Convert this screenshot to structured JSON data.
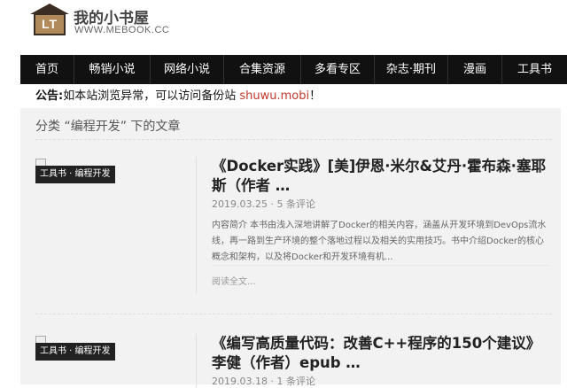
{
  "site": {
    "title": "我的小书屋",
    "url": "WWW.MEBOOK.CC",
    "logo_text": "LT"
  },
  "nav": [
    "首页",
    "畅销小说",
    "网络小说",
    "合集资源",
    "多看专区",
    "杂志·期刊",
    "漫画",
    "工具书"
  ],
  "notice": {
    "label": "公告:",
    "text": "如本站浏览异常，可以访问备份站 ",
    "link": "shuwu.mobi",
    "suffix": "！"
  },
  "category_title": "分类 “编程开发” 下的文章",
  "posts": [
    {
      "tag": "工具书 · 编程开发",
      "title": "《Docker实践》[美]伊恩·米尔&艾丹·霍布森·塞耶斯（作者 …",
      "meta": "2019.03.25 · 5 条评论",
      "excerpt": "内容简介 本书由浅入深地讲解了Docker的相关内容，涵盖从开发环境到DevOps流水线，再一路到生产环境的整个落地过程以及相关的实用技巧。书中介绍Docker的核心概念和架构，以及将Docker和开发环境有机...",
      "more": "阅读全文..."
    },
    {
      "tag": "工具书 · 编程开发",
      "title": "《编写高质量代码：改善C++程序的150个建议》李健（作者）epub …",
      "meta": "2019.03.18 · 1 条评论",
      "excerpt": "",
      "more": ""
    }
  ]
}
